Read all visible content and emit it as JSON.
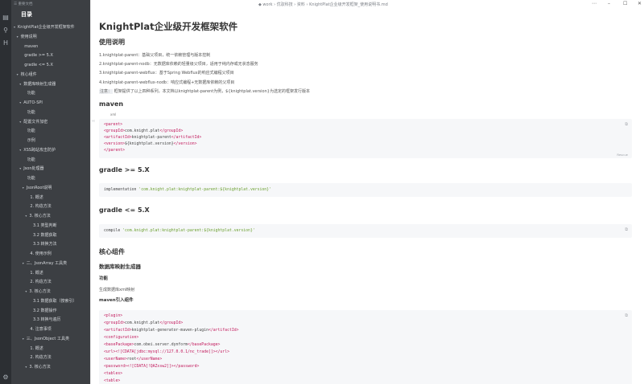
{
  "sidebar": {
    "app_label": "☰ 重要文档",
    "title": "目录",
    "items": [
      {
        "label": "KnightPlat企业级开发框架软件",
        "arrow": "▾"
      },
      {
        "label": "使用说明",
        "arrow": "▾"
      },
      {
        "label": "maven",
        "arrow": ""
      },
      {
        "label": "gradle >= 5.X",
        "arrow": ""
      },
      {
        "label": "gradle <= 5.X",
        "arrow": ""
      },
      {
        "label": "核心组件",
        "arrow": "▾"
      },
      {
        "label": "数据库映射生成器",
        "arrow": "▾"
      },
      {
        "label": "功能",
        "arrow": ""
      },
      {
        "label": "AUTO-SPI",
        "arrow": "▾"
      },
      {
        "label": "功能",
        "arrow": ""
      },
      {
        "label": "配置文件加密",
        "arrow": "▾"
      },
      {
        "label": "功能",
        "arrow": ""
      },
      {
        "label": "示例",
        "arrow": ""
      },
      {
        "label": "XSS跨站攻击防护",
        "arrow": "▾"
      },
      {
        "label": "功能",
        "arrow": ""
      },
      {
        "label": "Json处理器",
        "arrow": "▾"
      },
      {
        "label": "功能",
        "arrow": ""
      },
      {
        "label": "JsonRoot说明",
        "arrow": "▾"
      },
      {
        "label": "1. 概述",
        "arrow": ""
      },
      {
        "label": "2. 构造方法",
        "arrow": ""
      },
      {
        "label": "3. 核心方法",
        "arrow": "▾"
      },
      {
        "label": "3.1 类型判断",
        "arrow": ""
      },
      {
        "label": "3.2 数据获取",
        "arrow": ""
      },
      {
        "label": "3.3 转换方法",
        "arrow": ""
      },
      {
        "label": "4. 使用示例",
        "arrow": ""
      },
      {
        "label": "二、JsonArray 工具类",
        "arrow": "▾"
      },
      {
        "label": "1. 概述",
        "arrow": ""
      },
      {
        "label": "2. 构造方法",
        "arrow": ""
      },
      {
        "label": "3. 核心方法",
        "arrow": "▾"
      },
      {
        "label": "3.1 数据获取（按索引）",
        "arrow": ""
      },
      {
        "label": "3.2 数据操作",
        "arrow": ""
      },
      {
        "label": "3.3 转换与遍历",
        "arrow": ""
      },
      {
        "label": "4. 注意事项",
        "arrow": ""
      },
      {
        "label": "三、JsonObject 工具类",
        "arrow": "▾"
      },
      {
        "label": "1. 概述",
        "arrow": ""
      },
      {
        "label": "2. 构造方法",
        "arrow": ""
      },
      {
        "label": "3. 核心方法",
        "arrow": "▾"
      }
    ]
  },
  "titlebar": {
    "breadcrumb": "◆ work › 优驭科技 › 资料 › KnightPlat企业级开发框架_使用说明书.md",
    "buttons": [
      "⋯",
      "–",
      "☐",
      "✕"
    ]
  },
  "doc": {
    "title": "KnightPlat企业级开发框架软件",
    "usage_heading": "使用说明",
    "usage_lines": [
      "1.knightplat-parent：基础父项目，统一依赖管理与版本控制",
      "2.knightplat-parent-nodb：无数据库依赖的轻量级父项目，适用于纯内存或无状态服务",
      "3.knightplat-parent-webflux：基于Spring Webflux的响应式编程父项目",
      "4.knightplat-parent-webflux-nodb：响应式编程+无数据库依赖的父项目"
    ],
    "note_tag": "注意：",
    "note_text": "框架提供了以上四种系列，本文档以knightplat-parent为例，${knightplat.version}为选定的框架发行版本",
    "maven_heading": "maven",
    "maven_lang": "xml",
    "maven_code": [
      "<parent>",
      "    <groupId>com.knight.plat</groupId>",
      "    <artifactId>knightplat-parent</artifactId>",
      "    <version>${knightplat.version}</version>",
      "</parent>"
    ],
    "maven_footer_lang": "Rescue",
    "gradle_new_heading": "gradle >= 5.X",
    "gradle_new_code_keyword": "implementation ",
    "gradle_new_code_string": "'com.knight.plat:knightplat-parent:${knightplat.version}'",
    "gradle_old_heading": "gradle <= 5.X",
    "gradle_old_code_keyword": "compile ",
    "gradle_old_code_string": "'com.knight.plat:knightplat-parent:${knightplat.version}'",
    "core_heading": "核心组件",
    "db_heading": "数据库映射生成器",
    "func_heading": "功能",
    "func_text": "生成数据库xml映射",
    "maven_intro_heading": "maven引入组件",
    "plugin_code": [
      "<plugin>",
      "    <groupId>com.knight.plat</groupId>",
      "    <artifactId>knightplat-generator-maven-plugin</artifactId>",
      "    <configuration>",
      "        <basePackage>com.obei.server.dynform</basePackage>",
      "        <url><![CDATA[jdbc:mysql://127.0.0.1/nc_trade]]></url>",
      "        <userName>root</userName>",
      "        <password><![CDATA[!QAZxsw2]]></password>",
      "        <tables>",
      "            <table>",
      "                <module>answer</module>"
    ]
  }
}
